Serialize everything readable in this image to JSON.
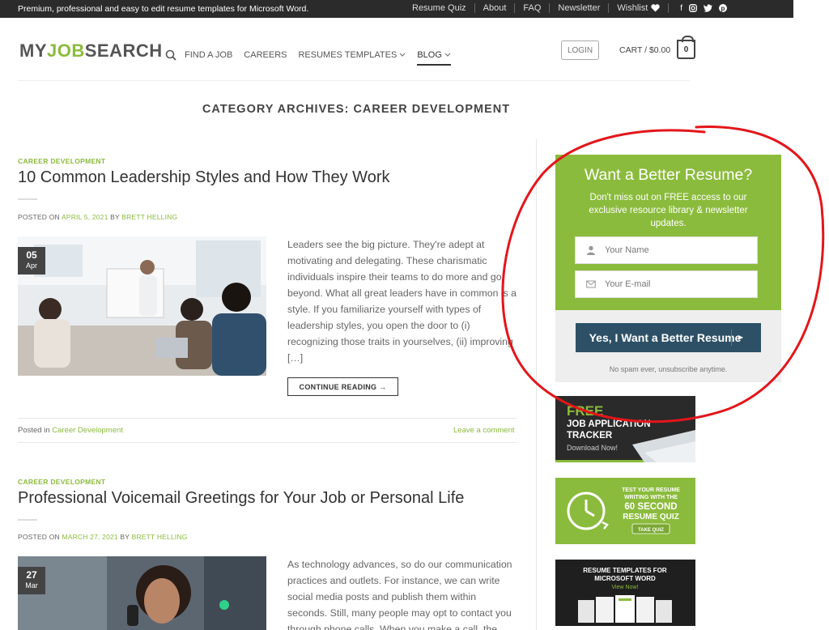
{
  "topbar": {
    "message": "Premium, professional and easy to edit resume templates for Microsoft Word.",
    "links": [
      "Resume Quiz",
      "About",
      "FAQ",
      "Newsletter",
      "Wishlist"
    ],
    "social": [
      "facebook-icon",
      "instagram-icon",
      "twitter-icon",
      "pinterest-icon"
    ]
  },
  "header": {
    "logo": {
      "part1": "MY",
      "part2": "JOB",
      "part3": "SEARCH"
    },
    "nav": [
      {
        "label": "FIND A JOB"
      },
      {
        "label": "CAREERS"
      },
      {
        "label": "RESUMES TEMPLATES"
      },
      {
        "label": "BLOG"
      }
    ],
    "login": "LOGIN",
    "cart_label": "CART / $0.00",
    "cart_count": "0"
  },
  "page_title": "CATEGORY ARCHIVES: CAREER DEVELOPMENT",
  "articles": [
    {
      "category": "CAREER DEVELOPMENT",
      "title": "10 Common Leadership Styles and How They Work",
      "meta_prefix": "POSTED ON ",
      "date": "APRIL 5, 2021",
      "meta_by": " BY ",
      "author": "BRETT HELLING",
      "badge_day": "05",
      "badge_month": "Apr",
      "excerpt": "Leaders see the big picture. They're adept at motivating and delegating. These charismatic individuals inspire their teams to do more and go beyond.  What all great leaders have in common is a style. If you familiarize yourself with types of leadership styles, you open the door to (i) recognizing those traits in yourselves, (ii) improving […]",
      "continue": "CONTINUE READING →",
      "posted_in_prefix": "Posted in ",
      "posted_in": "Career Development",
      "comment": "Leave a comment"
    },
    {
      "category": "CAREER DEVELOPMENT",
      "title": "Professional Voicemail Greetings for Your Job or Personal Life",
      "meta_prefix": "POSTED ON ",
      "date": "MARCH 27, 2021",
      "meta_by": " BY ",
      "author": "BRETT HELLING",
      "badge_day": "27",
      "badge_month": "Mar",
      "excerpt": "As technology advances, so do our communication practices and outlets. For instance, we can write social media posts and publish them within seconds. Still, many people may opt to contact you through phone calls. When you make a call, the"
    }
  ],
  "widget": {
    "title": "Want a Better Resume?",
    "subtitle": "Don't miss out on FREE access to our exclusive resource library & newsletter updates.",
    "name_placeholder": "Your Name",
    "email_placeholder": "Your E-mail",
    "button": "Yes, I Want a Better Resume",
    "note": "No spam ever, unsubscribe anytime."
  },
  "banners": {
    "tracker": {
      "line1": "FREE",
      "line2": "JOB APPLICATION",
      "line3": "TRACKER",
      "line4": "Download Now!"
    },
    "quiz": {
      "line1": "TEST YOUR RESUME",
      "line2": "WRITING WITH THE",
      "line3": "60 SECOND",
      "line4": "RESUME QUIZ",
      "cta": "TAKE QUIZ"
    },
    "templates": {
      "line1": "RESUME TEMPLATES FOR",
      "line2": "MICROSOFT WORD",
      "cta": "View Now!"
    }
  },
  "colors": {
    "accent": "#8bbb3c",
    "dark": "#2b2b2b",
    "button": "#2d5066",
    "annotation": "#e3161b"
  }
}
